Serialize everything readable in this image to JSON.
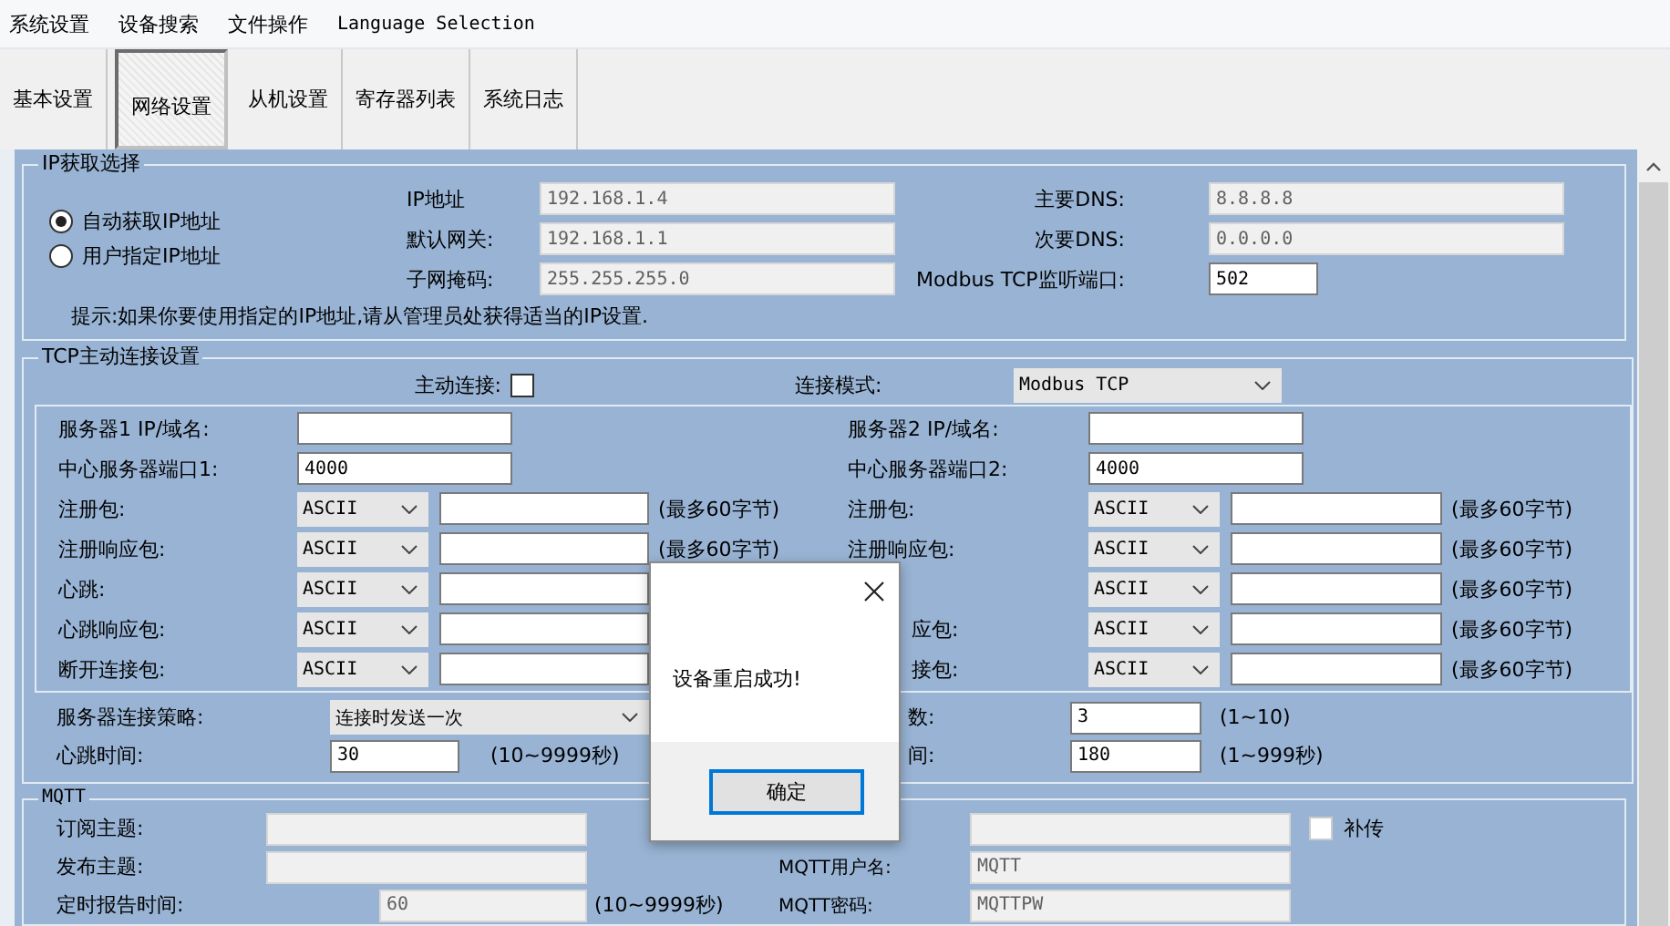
{
  "menu": [
    {
      "label": "系统设置"
    },
    {
      "label": "设备搜索"
    },
    {
      "label": "文件操作"
    },
    {
      "label": "Language Selection"
    }
  ],
  "tabs": [
    {
      "label": "基本设置",
      "selected": false
    },
    {
      "label": "网络设置",
      "selected": true
    },
    {
      "label": "从机设置",
      "selected": false
    },
    {
      "label": "寄存器列表",
      "selected": false
    },
    {
      "label": "系统日志",
      "selected": false
    }
  ],
  "ip_group": {
    "title": "IP获取选择",
    "options": [
      {
        "label": "自动获取IP地址",
        "selected": true
      },
      {
        "label": "用户指定IP地址",
        "selected": false
      }
    ],
    "left_fields": [
      {
        "label": "IP地址",
        "value": "192.168.1.4",
        "disabled": true
      },
      {
        "label": "默认网关:",
        "value": "192.168.1.1",
        "disabled": true
      },
      {
        "label": "子网掩码:",
        "value": "255.255.255.0",
        "disabled": true
      }
    ],
    "right_fields": [
      {
        "label": "主要DNS:",
        "value": "8.8.8.8",
        "disabled": true
      },
      {
        "label": "次要DNS:",
        "value": "0.0.0.0",
        "disabled": true
      },
      {
        "label": "Modbus TCP监听端口:",
        "value": "502",
        "disabled": false
      }
    ],
    "hint": "提示:如果你要使用指定的IP地址,请从管理员处获得适当的IP设置."
  },
  "tcp_group": {
    "title": "TCP主动连接设置",
    "active_connect": {
      "label": "主动连接:",
      "checked": false
    },
    "mode": {
      "label": "连接模式:",
      "value": "Modbus TCP"
    },
    "server_1": [
      {
        "kind": "text",
        "label": "服务器1 IP/域名:"
      },
      {
        "kind": "text",
        "label": "中心服务器端口1:",
        "value": "4000"
      },
      {
        "kind": "packet",
        "label": "注册包:",
        "encoding": "ASCII",
        "note": "(最多60字节)"
      },
      {
        "kind": "packet",
        "label": "注册响应包:",
        "encoding": "ASCII",
        "note": "(最多60字节)"
      },
      {
        "kind": "packet",
        "label": "心跳:",
        "encoding": "ASCII"
      },
      {
        "kind": "packet",
        "label": "心跳响应包:",
        "encoding": "ASCII"
      },
      {
        "kind": "packet",
        "label": "断开连接包:",
        "encoding": "ASCII"
      }
    ],
    "server_2": [
      {
        "kind": "text",
        "label": "服务器2 IP/域名:",
        "clipped": false
      },
      {
        "kind": "text",
        "label": "中心服务器端口2:",
        "value": "4000",
        "clipped": false
      },
      {
        "kind": "packet",
        "label": "注册包:",
        "encoding": "ASCII",
        "note": "(最多60字节)",
        "clipped": false
      },
      {
        "kind": "packet",
        "label": "注册响应包:",
        "encoding": "ASCII",
        "note": "(最多60字节)",
        "clipped": false
      },
      {
        "kind": "packet",
        "encoding": "ASCII",
        "note": "(最多60字节)"
      },
      {
        "kind": "packet",
        "label": "应包:",
        "encoding": "ASCII",
        "note": "(最多60字节)",
        "clipped": true
      },
      {
        "kind": "packet",
        "label": "接包:",
        "encoding": "ASCII",
        "note": "(最多60字节)",
        "clipped": true
      }
    ],
    "strategy": {
      "label": "服务器连接策略:",
      "value": "连接时发送一次"
    },
    "heartbeat": {
      "label": "心跳时间:",
      "value": "30",
      "note": "(10~9999秒)"
    },
    "retry_count": {
      "label": "数:",
      "value": "3",
      "note": "(1~10)"
    },
    "retry_interval": {
      "label": "间:",
      "value": "180",
      "note": "(1~999秒)"
    }
  },
  "mqtt": {
    "title": "MQTT",
    "disabled": true,
    "rows": [
      {
        "left": {
          "label": "订阅主题:"
        },
        "right": {
          "checkbox": {
            "label": "补传",
            "checked": false
          }
        }
      },
      {
        "left": {
          "label": "发布主题:"
        },
        "right": {
          "label": "MQTT用户名:",
          "value": "MQTT"
        }
      },
      {
        "left": {
          "label": "定时报告时间:",
          "value": "60",
          "note": "(10~9999秒)"
        },
        "right": {
          "label": "MQTT密码:",
          "value": "MQTTPW"
        }
      }
    ]
  },
  "dialog": {
    "message": "设备重启成功!",
    "button": "确定"
  }
}
